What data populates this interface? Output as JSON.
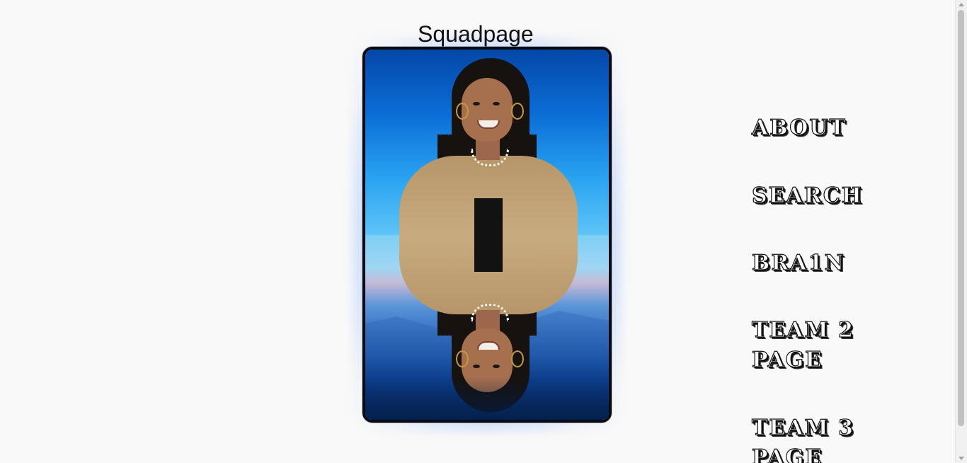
{
  "page": {
    "title": "Squadpage"
  },
  "profile_card": {
    "image_alt": "Portrait photo of a smiling young woman with long dark hair wearing a tan cardigan, with a mirrored reflection below"
  },
  "nav": {
    "items": [
      {
        "label": "About"
      },
      {
        "label": "Search"
      },
      {
        "label": "Bra1n"
      },
      {
        "label": "Team 2 Page"
      },
      {
        "label": "Team 3 Page"
      }
    ]
  },
  "colors": {
    "background": "#f9f9f9",
    "card_border": "#0a0a14",
    "card_glow": "#5096ff",
    "sky_top": "#0447a8",
    "sky_bottom": "#5fc4f7"
  }
}
